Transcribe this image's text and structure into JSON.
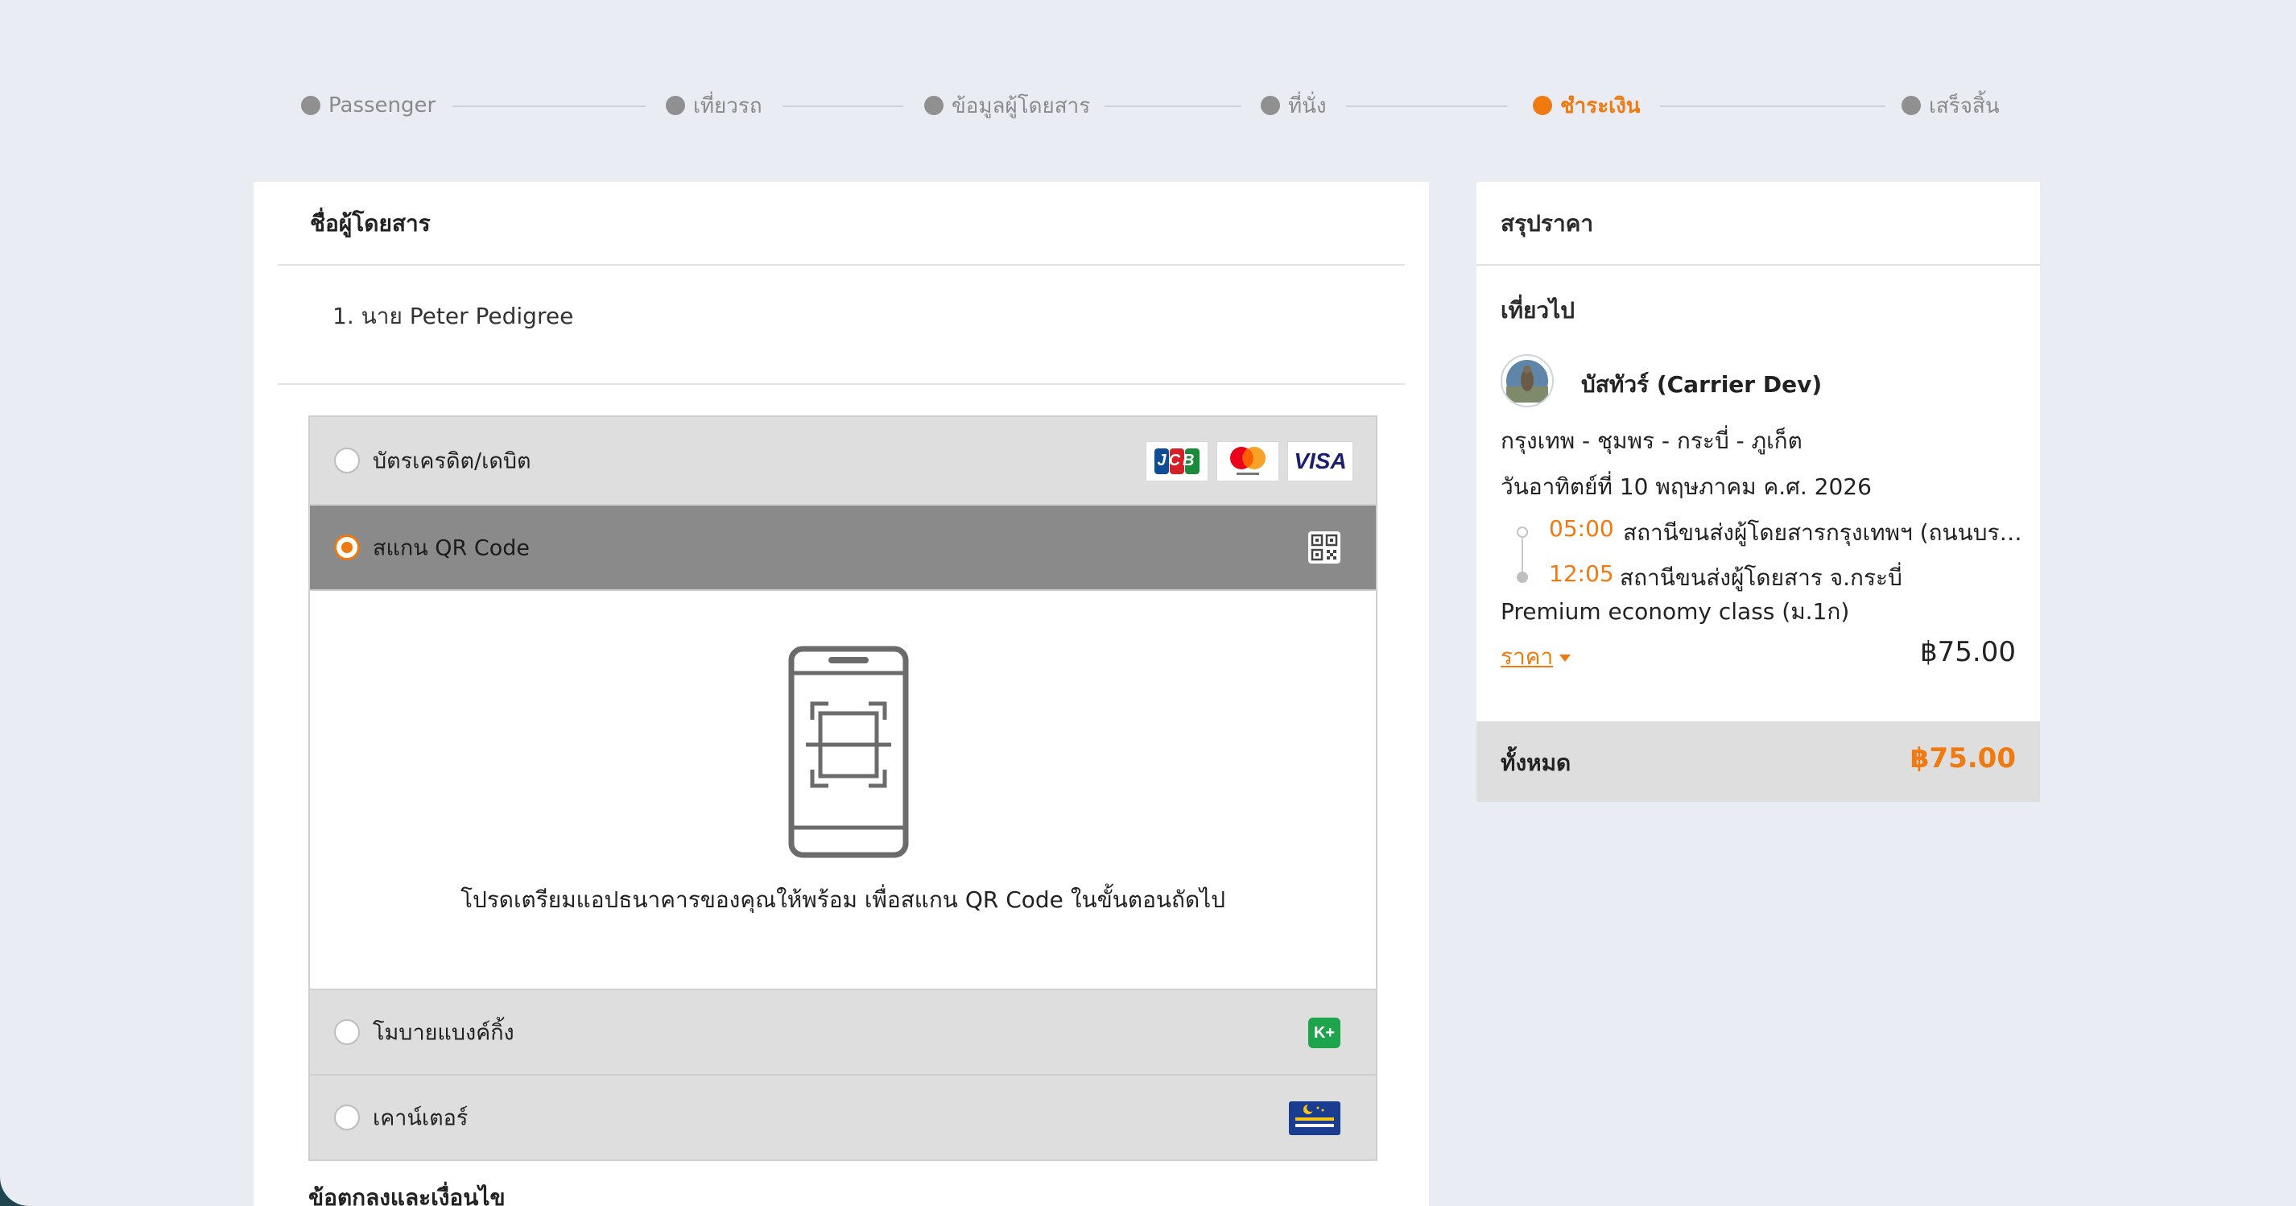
{
  "steps": [
    {
      "label": "Passenger",
      "state": "done"
    },
    {
      "label": "เที่ยวรถ",
      "state": "done"
    },
    {
      "label": "ข้อมูลผู้โดยสาร",
      "state": "done"
    },
    {
      "label": "ที่นั่ง",
      "state": "done"
    },
    {
      "label": "ชำระเงิน",
      "state": "active"
    },
    {
      "label": "เสร็จสิ้น",
      "state": "pending"
    }
  ],
  "passenger": {
    "section_title": "ชื่อผู้โดยสาร",
    "list": [
      "1. นาย Peter Pedigree"
    ]
  },
  "payment": {
    "methods": [
      {
        "label": "บัตรเครดิต/เดบิต",
        "selected": false,
        "icons": [
          "jcb-icon",
          "mastercard-icon",
          "visa-icon"
        ]
      },
      {
        "label": "สแกน QR Code",
        "selected": true,
        "icons": [
          "qr-code-icon"
        ]
      },
      {
        "label": "โมบายแบงค์กิ้ง",
        "selected": false,
        "icons": [
          "kplus-icon"
        ]
      },
      {
        "label": "เคาน์เตอร์",
        "selected": false,
        "icons": [
          "counter-service-icon"
        ]
      }
    ],
    "qr_message": "โปรดเตรียมแอปธนาคารของคุณให้พร้อม เพื่อสแกน QR Code ในขั้นตอนถัดไป",
    "visa_text": "VISA",
    "jcb_text": "JCB",
    "kplus_text": "K+"
  },
  "terms_title": "ข้อตกลงและเงื่อนไข",
  "summary": {
    "title": "สรุปราคา",
    "trip_label": "เที่ยวไป",
    "carrier": "บัสทัวร์ (Carrier Dev)",
    "route": "กรุงเทพ - ชุมพร - กระบี่ - ภูเก็ต",
    "date": "วันอาทิตย์ที่ 10 พฤษภาคม ค.ศ. 2026",
    "depart_time": "05:00",
    "depart_station": "สถานีขนส่งผู้โดยสารกรุงเทพฯ (ถนนบรมราชชนนี)",
    "arrive_time": "12:05",
    "arrive_station": "สถานีขนส่งผู้โดยสาร จ.กระบี่",
    "class": "Premium economy class (ม.1ก)",
    "price_label": "ราคา",
    "price": "฿75.00",
    "total_label": "ทั้งหมด",
    "total": "฿75.00"
  },
  "colors": {
    "accent": "#f07a10",
    "page_bg": "#e9edf3",
    "selected_method_bg": "#8a8a8a",
    "method_bg": "#dedede"
  }
}
